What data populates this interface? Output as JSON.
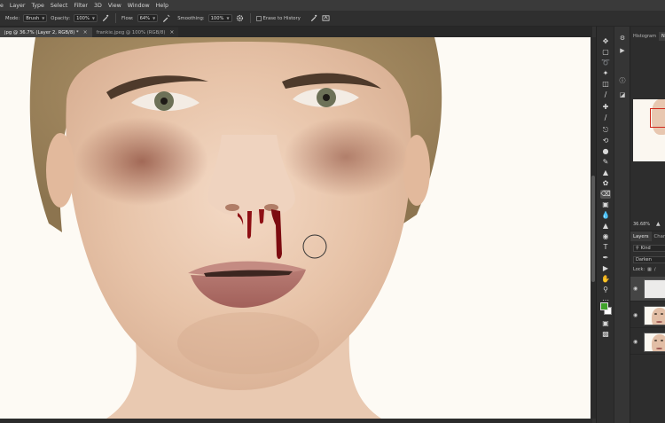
{
  "menu": {
    "items": [
      "e",
      "Layer",
      "Type",
      "Select",
      "Filter",
      "3D",
      "View",
      "Window",
      "Help"
    ]
  },
  "options": {
    "mode_label": "Mode:",
    "mode_value": "Brush",
    "opacity_label": "Opacity:",
    "opacity_value": "100%",
    "flow_label": "Flow:",
    "flow_value": "64%",
    "smoothing_label": "Smoothing:",
    "smoothing_value": "100%",
    "erase_history_label": "Erase to History"
  },
  "tabs": [
    {
      "label": "jpg @ 36.7% (Layer 2, RGB/8) *",
      "active": true
    },
    {
      "label": "frankie.jpeg @ 100% (RGB/8)",
      "active": false
    }
  ],
  "right_panel": {
    "top_tabs": [
      "Histogram",
      "N"
    ],
    "zoom": "36.68%",
    "layers_tabs": [
      "Layers",
      "Chan"
    ],
    "kind_filter": "Kind",
    "blend_mode": "Darken",
    "lock_label": "Lock:"
  },
  "colors": {
    "foreground": "#3fa22a",
    "background": "#ffffff",
    "accent": "#d0281c"
  },
  "icons": {
    "tools": [
      "move-icon",
      "marquee-icon",
      "lasso-icon",
      "quick-select-icon",
      "crop-icon",
      "eyedropper-icon",
      "healing-icon",
      "brush-icon",
      "clone-stamp-icon",
      "history-brush-icon",
      "eraser-icon",
      "gradient-icon",
      "blur-icon",
      "dodge-icon",
      "pen-icon",
      "type-icon",
      "path-select-icon",
      "shape-icon",
      "hand-icon",
      "zoom-icon",
      "more-tools-icon"
    ],
    "strip": [
      "properties-icon",
      "play-icon",
      "info-icon",
      "adjustments-icon"
    ]
  }
}
